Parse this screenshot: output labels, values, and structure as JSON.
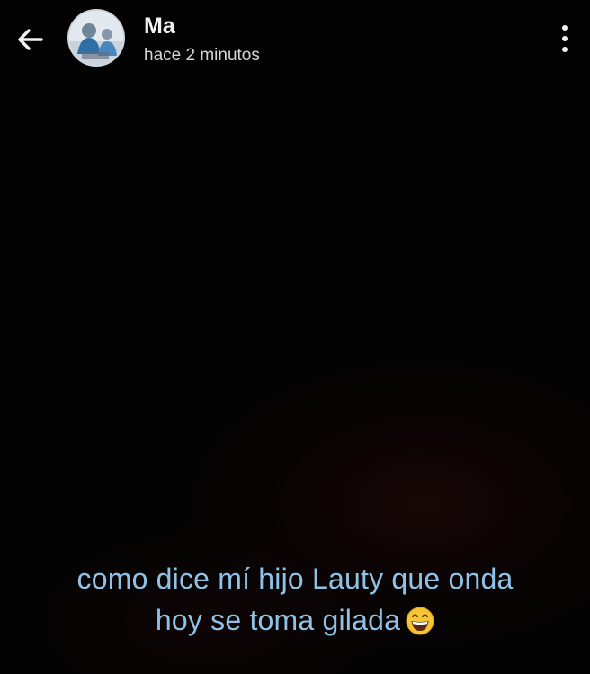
{
  "header": {
    "back_icon": "arrow-left-icon",
    "contact_name": "Ma",
    "timestamp": "hace 2 minutos",
    "menu_icon": "more-vertical-icon"
  },
  "status": {
    "caption_line_1": "como dice mí hijo Lauty que onda",
    "caption_line_2": "hoy se toma gilada",
    "caption_emoji": "grinning-face-emoji",
    "caption_color": "#8fc2e6"
  },
  "colors": {
    "background": "#030303",
    "header_text": "#f2f2f2"
  }
}
